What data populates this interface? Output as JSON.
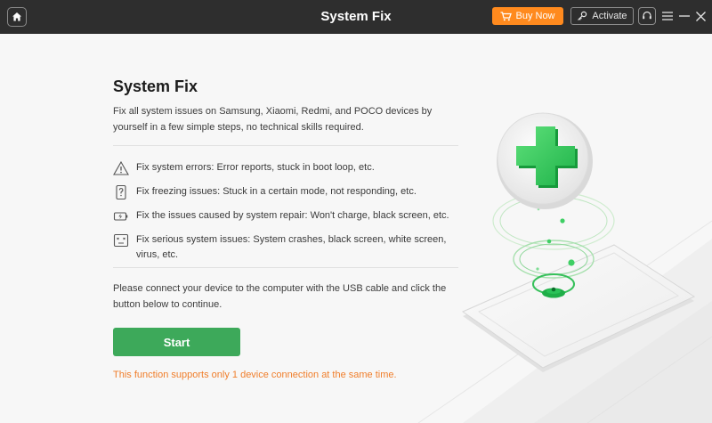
{
  "titlebar": {
    "title": "System Fix",
    "buy_label": "Buy Now",
    "activate_label": "Activate",
    "accent_color": "#ff8a1e"
  },
  "main": {
    "heading": "System Fix",
    "description": "Fix all system issues on Samsung, Xiaomi, Redmi, and POCO devices by yourself in a few simple steps, no technical skills required.",
    "features": [
      {
        "icon": "warning-triangle-icon",
        "text": "Fix system errors: Error reports, stuck in boot loop, etc."
      },
      {
        "icon": "phone-question-icon",
        "text": "Fix freezing issues: Stuck in a certain mode, not responding, etc."
      },
      {
        "icon": "battery-charge-icon",
        "text": "Fix the issues caused by system repair: Won't charge, black screen, etc."
      },
      {
        "icon": "screen-crash-icon",
        "text": "Fix serious system issues: System crashes, black screen, white screen, virus, etc."
      }
    ],
    "connect_text": "Please connect your device to the computer with the USB cable and click the button below to continue.",
    "start_label": "Start",
    "start_color": "#3da95a",
    "note": "This function supports only 1 device connection at the same time.",
    "note_color": "#f07e2b"
  }
}
